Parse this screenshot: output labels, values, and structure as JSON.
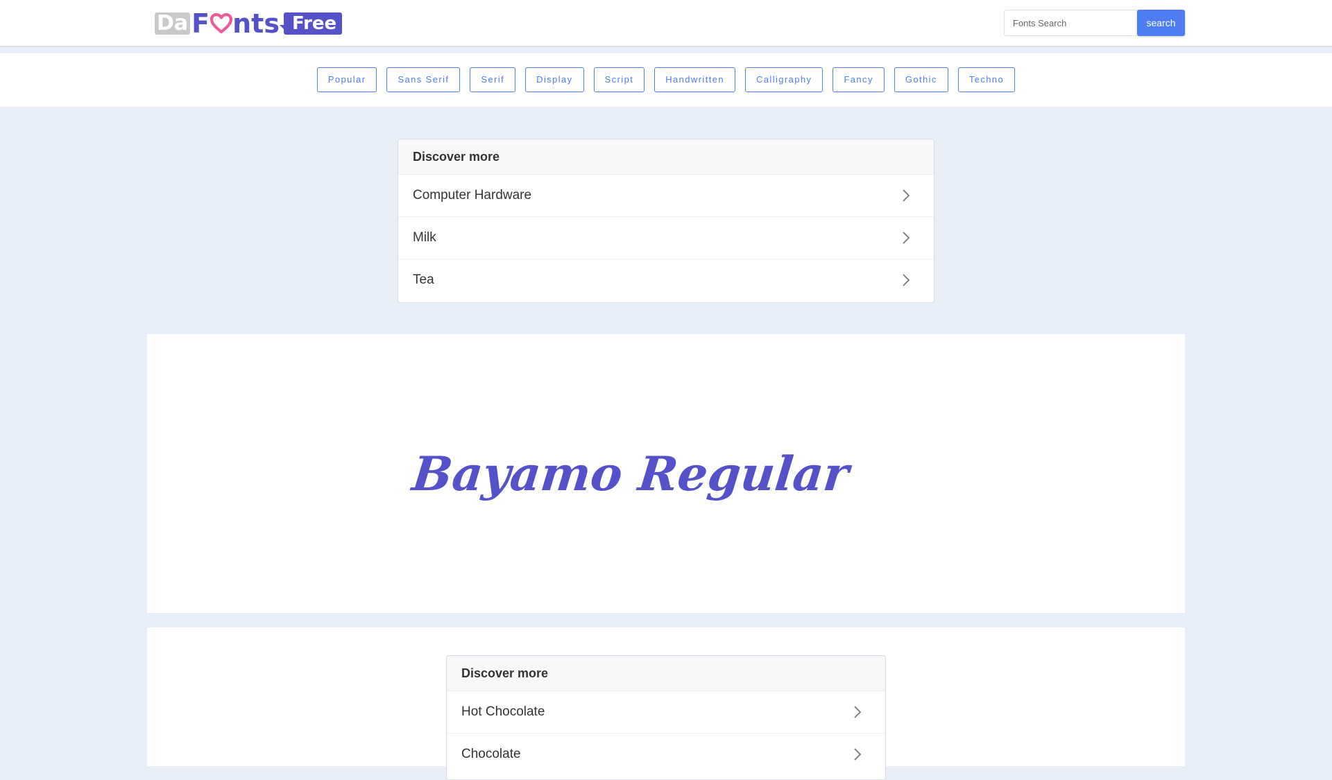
{
  "header": {
    "logo": {
      "part1": "Da",
      "part2_before_heart": "F",
      "part2_after_heart": "nts",
      "part3": "Free"
    },
    "search": {
      "placeholder": "Fonts Search",
      "value": "",
      "button_label": "search"
    }
  },
  "categories": [
    "Popular",
    "Sans Serif",
    "Serif",
    "Display",
    "Script",
    "Handwritten",
    "Calligraphy",
    "Fancy",
    "Gothic",
    "Techno"
  ],
  "discover_top": {
    "title": "Discover more",
    "items": [
      "Computer Hardware",
      "Milk",
      "Tea"
    ]
  },
  "preview": {
    "text": "Bayamo Regular",
    "color": "#5552c9"
  },
  "discover_bottom": {
    "title": "Discover more",
    "items": [
      "Hot Chocolate",
      "Chocolate"
    ]
  },
  "colors": {
    "brand": "#5552c9",
    "accent": "#4f7cf0",
    "background": "#e8eef7",
    "heart": "#ec5a9a"
  }
}
